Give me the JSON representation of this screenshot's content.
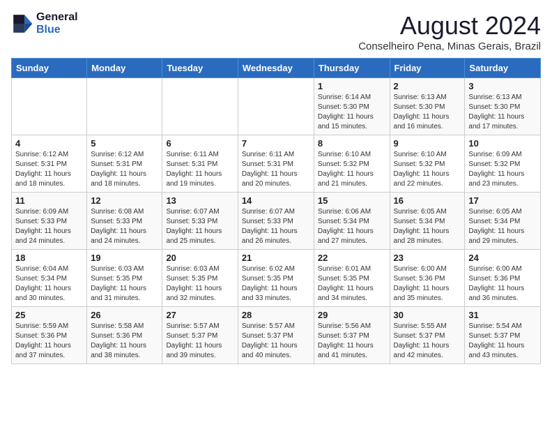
{
  "logo": {
    "line1": "General",
    "line2": "Blue"
  },
  "title": {
    "month_year": "August 2024",
    "location": "Conselheiro Pena, Minas Gerais, Brazil"
  },
  "header": {
    "days": [
      "Sunday",
      "Monday",
      "Tuesday",
      "Wednesday",
      "Thursday",
      "Friday",
      "Saturday"
    ]
  },
  "weeks": [
    {
      "cells": [
        {
          "day": "",
          "info": ""
        },
        {
          "day": "",
          "info": ""
        },
        {
          "day": "",
          "info": ""
        },
        {
          "day": "",
          "info": ""
        },
        {
          "day": "1",
          "info": "Sunrise: 6:14 AM\nSunset: 5:30 PM\nDaylight: 11 hours\nand 15 minutes."
        },
        {
          "day": "2",
          "info": "Sunrise: 6:13 AM\nSunset: 5:30 PM\nDaylight: 11 hours\nand 16 minutes."
        },
        {
          "day": "3",
          "info": "Sunrise: 6:13 AM\nSunset: 5:30 PM\nDaylight: 11 hours\nand 17 minutes."
        }
      ]
    },
    {
      "cells": [
        {
          "day": "4",
          "info": "Sunrise: 6:12 AM\nSunset: 5:31 PM\nDaylight: 11 hours\nand 18 minutes."
        },
        {
          "day": "5",
          "info": "Sunrise: 6:12 AM\nSunset: 5:31 PM\nDaylight: 11 hours\nand 18 minutes."
        },
        {
          "day": "6",
          "info": "Sunrise: 6:11 AM\nSunset: 5:31 PM\nDaylight: 11 hours\nand 19 minutes."
        },
        {
          "day": "7",
          "info": "Sunrise: 6:11 AM\nSunset: 5:31 PM\nDaylight: 11 hours\nand 20 minutes."
        },
        {
          "day": "8",
          "info": "Sunrise: 6:10 AM\nSunset: 5:32 PM\nDaylight: 11 hours\nand 21 minutes."
        },
        {
          "day": "9",
          "info": "Sunrise: 6:10 AM\nSunset: 5:32 PM\nDaylight: 11 hours\nand 22 minutes."
        },
        {
          "day": "10",
          "info": "Sunrise: 6:09 AM\nSunset: 5:32 PM\nDaylight: 11 hours\nand 23 minutes."
        }
      ]
    },
    {
      "cells": [
        {
          "day": "11",
          "info": "Sunrise: 6:09 AM\nSunset: 5:33 PM\nDaylight: 11 hours\nand 24 minutes."
        },
        {
          "day": "12",
          "info": "Sunrise: 6:08 AM\nSunset: 5:33 PM\nDaylight: 11 hours\nand 24 minutes."
        },
        {
          "day": "13",
          "info": "Sunrise: 6:07 AM\nSunset: 5:33 PM\nDaylight: 11 hours\nand 25 minutes."
        },
        {
          "day": "14",
          "info": "Sunrise: 6:07 AM\nSunset: 5:33 PM\nDaylight: 11 hours\nand 26 minutes."
        },
        {
          "day": "15",
          "info": "Sunrise: 6:06 AM\nSunset: 5:34 PM\nDaylight: 11 hours\nand 27 minutes."
        },
        {
          "day": "16",
          "info": "Sunrise: 6:05 AM\nSunset: 5:34 PM\nDaylight: 11 hours\nand 28 minutes."
        },
        {
          "day": "17",
          "info": "Sunrise: 6:05 AM\nSunset: 5:34 PM\nDaylight: 11 hours\nand 29 minutes."
        }
      ]
    },
    {
      "cells": [
        {
          "day": "18",
          "info": "Sunrise: 6:04 AM\nSunset: 5:34 PM\nDaylight: 11 hours\nand 30 minutes."
        },
        {
          "day": "19",
          "info": "Sunrise: 6:03 AM\nSunset: 5:35 PM\nDaylight: 11 hours\nand 31 minutes."
        },
        {
          "day": "20",
          "info": "Sunrise: 6:03 AM\nSunset: 5:35 PM\nDaylight: 11 hours\nand 32 minutes."
        },
        {
          "day": "21",
          "info": "Sunrise: 6:02 AM\nSunset: 5:35 PM\nDaylight: 11 hours\nand 33 minutes."
        },
        {
          "day": "22",
          "info": "Sunrise: 6:01 AM\nSunset: 5:35 PM\nDaylight: 11 hours\nand 34 minutes."
        },
        {
          "day": "23",
          "info": "Sunrise: 6:00 AM\nSunset: 5:36 PM\nDaylight: 11 hours\nand 35 minutes."
        },
        {
          "day": "24",
          "info": "Sunrise: 6:00 AM\nSunset: 5:36 PM\nDaylight: 11 hours\nand 36 minutes."
        }
      ]
    },
    {
      "cells": [
        {
          "day": "25",
          "info": "Sunrise: 5:59 AM\nSunset: 5:36 PM\nDaylight: 11 hours\nand 37 minutes."
        },
        {
          "day": "26",
          "info": "Sunrise: 5:58 AM\nSunset: 5:36 PM\nDaylight: 11 hours\nand 38 minutes."
        },
        {
          "day": "27",
          "info": "Sunrise: 5:57 AM\nSunset: 5:37 PM\nDaylight: 11 hours\nand 39 minutes."
        },
        {
          "day": "28",
          "info": "Sunrise: 5:57 AM\nSunset: 5:37 PM\nDaylight: 11 hours\nand 40 minutes."
        },
        {
          "day": "29",
          "info": "Sunrise: 5:56 AM\nSunset: 5:37 PM\nDaylight: 11 hours\nand 41 minutes."
        },
        {
          "day": "30",
          "info": "Sunrise: 5:55 AM\nSunset: 5:37 PM\nDaylight: 11 hours\nand 42 minutes."
        },
        {
          "day": "31",
          "info": "Sunrise: 5:54 AM\nSunset: 5:37 PM\nDaylight: 11 hours\nand 43 minutes."
        }
      ]
    }
  ]
}
